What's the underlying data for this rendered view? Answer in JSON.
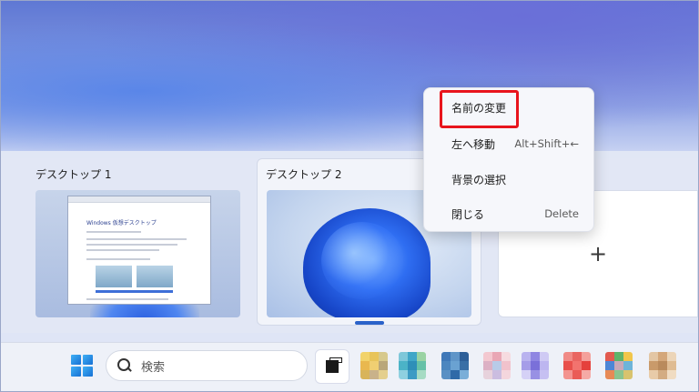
{
  "desktops": [
    {
      "label": "デスクトップ 1"
    },
    {
      "label": "デスクトップ 2"
    }
  ],
  "thumb1": {
    "window_title": "Windows 仮想デスクトップ"
  },
  "new_desktop": {
    "symbol": "+"
  },
  "context_menu": {
    "items": [
      {
        "label": "名前の変更",
        "shortcut": ""
      },
      {
        "label": "左へ移動",
        "shortcut": "Alt+Shift+←"
      },
      {
        "label": "背景の選択",
        "shortcut": ""
      },
      {
        "label": "閉じる",
        "shortcut": "Delete"
      }
    ]
  },
  "taskbar": {
    "search_label": "検索"
  },
  "colors": {
    "highlight": "#e8141c",
    "accent": "#2a62c9"
  },
  "icons": {
    "start": "windows-logo",
    "search": "magnifier",
    "task_view": "task-view"
  }
}
